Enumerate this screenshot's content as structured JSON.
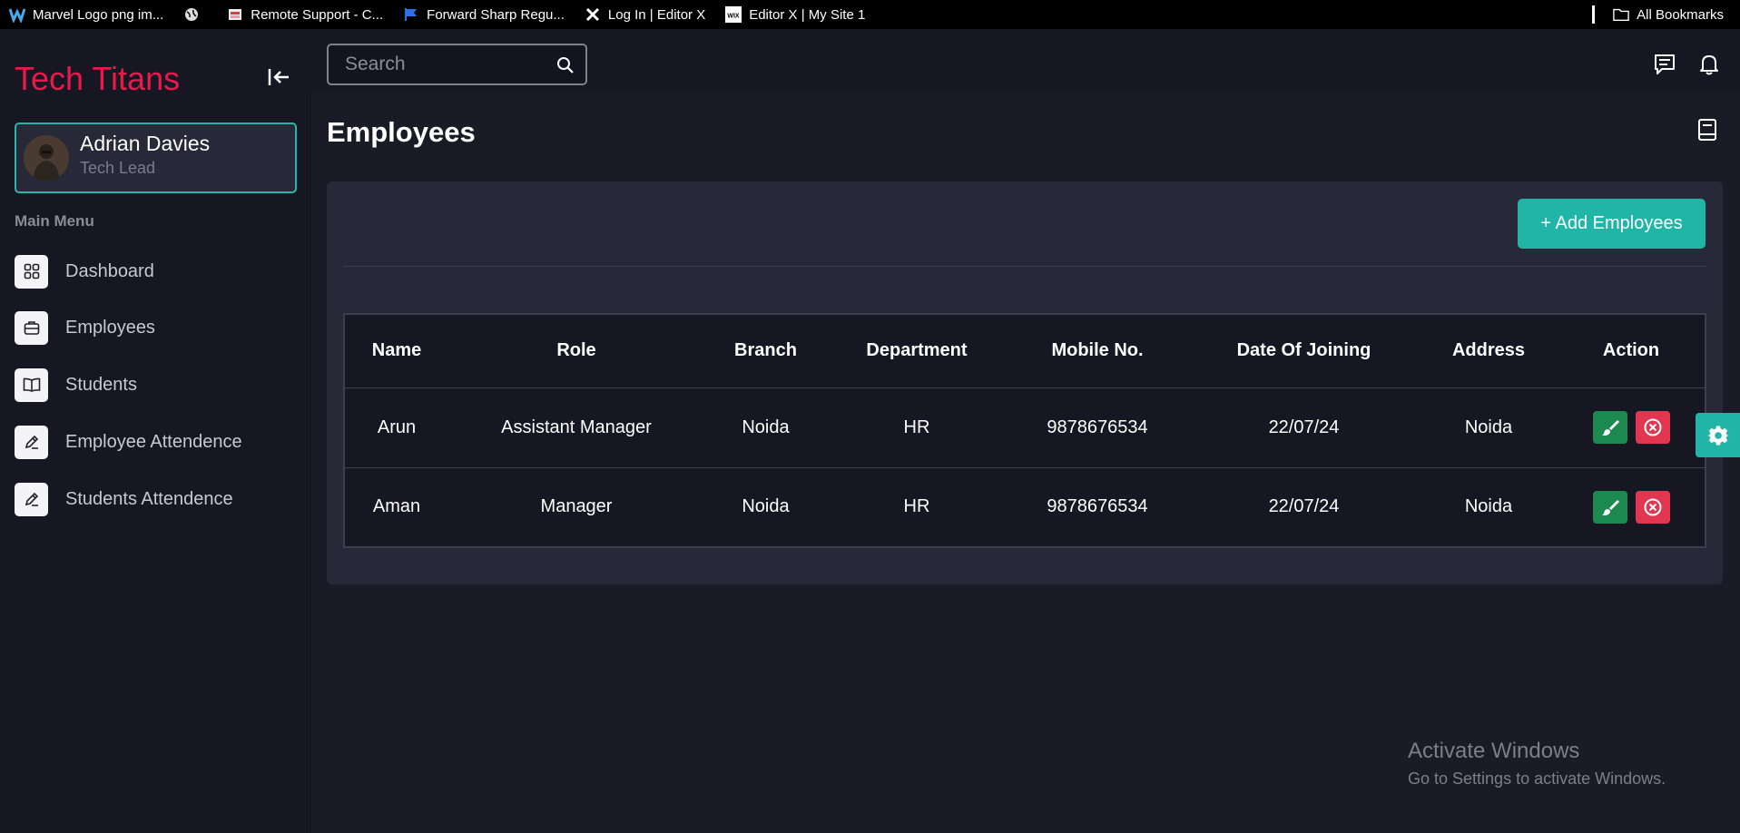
{
  "bookmarks": [
    {
      "label": "Marvel Logo png im...",
      "icon": "marvel-logo-icon"
    },
    {
      "label": "",
      "icon": "globe-icon"
    },
    {
      "label": "Remote Support - C...",
      "icon": "remote-support-icon"
    },
    {
      "label": "Forward Sharp Regu...",
      "icon": "flag-icon"
    },
    {
      "label": "Log In | Editor X",
      "icon": "editor-x-icon"
    },
    {
      "label": "Editor X | My Site 1",
      "icon": "wix-icon"
    }
  ],
  "all_bookmarks": "All Bookmarks",
  "sidebar": {
    "brand": "Tech Titans",
    "profile": {
      "name": "Adrian Davies",
      "role": "Tech Lead"
    },
    "menu_title": "Main Menu",
    "items": [
      {
        "label": "Dashboard",
        "icon": "grid-icon"
      },
      {
        "label": "Employees",
        "icon": "briefcase-icon"
      },
      {
        "label": "Students",
        "icon": "book-icon"
      },
      {
        "label": "Employee Attendence",
        "icon": "pencil-icon"
      },
      {
        "label": "Students Attendence",
        "icon": "pencil-icon"
      }
    ]
  },
  "header": {
    "search_placeholder": "Search"
  },
  "main": {
    "title": "Employees",
    "add_button": "+ Add Employees",
    "columns": [
      "Name",
      "Role",
      "Branch",
      "Department",
      "Mobile No.",
      "Date Of Joining",
      "Address",
      "Action"
    ],
    "rows": [
      [
        "Arun",
        "Assistant Manager",
        "Noida",
        "HR",
        "9878676534",
        "22/07/24",
        "Noida"
      ],
      [
        "Aman",
        "Manager",
        "Noida",
        "HR",
        "9878676534",
        "22/07/24",
        "Noida"
      ]
    ]
  },
  "watermark": {
    "title": "Activate Windows",
    "subtitle": "Go to Settings to activate Windows."
  },
  "colors": {
    "brand": "#e8194b",
    "accent": "#20b5a6",
    "edit": "#1c8a4f",
    "delete": "#e0364f"
  }
}
